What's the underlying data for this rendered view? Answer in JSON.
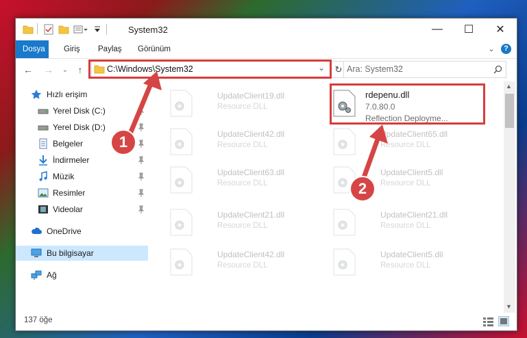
{
  "window": {
    "title": "System32",
    "controls": {
      "minimize": "—",
      "maximize": "☐",
      "close": "✕"
    }
  },
  "ribbon": {
    "tabs": [
      {
        "label": "Dosya",
        "active": true
      },
      {
        "label": "Giriş"
      },
      {
        "label": "Paylaş"
      },
      {
        "label": "Görünüm"
      }
    ]
  },
  "nav": {
    "address": "C:\\Windows\\System32",
    "search_placeholder": "Ara: System32"
  },
  "sidebar": {
    "items": [
      {
        "label": "Hızlı erişim",
        "icon": "star-icon",
        "pinned": false
      },
      {
        "label": "Yerel Disk (C:)",
        "icon": "drive-icon",
        "pinned": true
      },
      {
        "label": "Yerel Disk (D:)",
        "icon": "drive-icon",
        "pinned": true
      },
      {
        "label": "Belgeler",
        "icon": "documents-icon",
        "pinned": true
      },
      {
        "label": "İndirmeler",
        "icon": "download-icon",
        "pinned": true
      },
      {
        "label": "Müzik",
        "icon": "music-icon",
        "pinned": true
      },
      {
        "label": "Resimler",
        "icon": "pictures-icon",
        "pinned": true
      },
      {
        "label": "Videolar",
        "icon": "videos-icon",
        "pinned": true
      },
      {
        "label": "OneDrive",
        "icon": "cloud-icon",
        "pinned": false
      },
      {
        "label": "Bu bilgisayar",
        "icon": "computer-icon",
        "pinned": false,
        "selected": true
      },
      {
        "label": "Ağ",
        "icon": "network-icon",
        "pinned": false
      }
    ]
  },
  "files": {
    "left_column": [
      {
        "name": "UpdateClient19.dll",
        "desc": "Resource DLL"
      },
      {
        "name": "UpdateClient42.dll",
        "desc": "Resource DLL"
      },
      {
        "name": "UpdateClient63.dll",
        "desc": "Resource DLL"
      },
      {
        "name": "UpdateClient21.dll",
        "desc": "Resource DLL"
      },
      {
        "name": "UpdateClient42.dll",
        "desc": "Resource DLL"
      }
    ],
    "highlighted": {
      "name": "rdepenu.dll",
      "version": "7.0.80.0",
      "desc": "Reflection Deployme..."
    },
    "right_column": [
      {
        "name": "UpdateClient65.dll",
        "desc": "Resource DLL"
      },
      {
        "name": "UpdateClient5.dll",
        "desc": "Resource DLL"
      },
      {
        "name": "UpdateClient21.dll",
        "desc": "Resource DLL"
      },
      {
        "name": "UpdateClient5.dll",
        "desc": "Resource DLL"
      }
    ]
  },
  "status": {
    "item_count": "137 öğe"
  },
  "callouts": {
    "step1": "1",
    "step2": "2"
  },
  "colors": {
    "accent": "#1979ca",
    "highlight_box": "#d93a3a",
    "selected_bg": "#cce8ff"
  }
}
